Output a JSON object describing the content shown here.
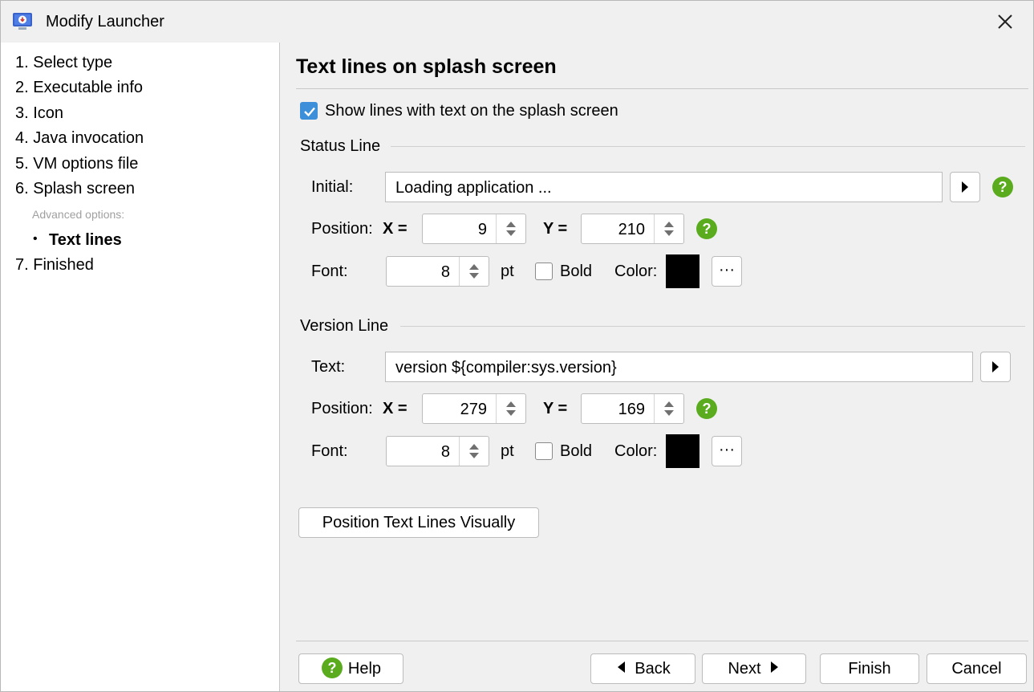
{
  "window": {
    "title": "Modify Launcher"
  },
  "sidebar": {
    "steps": [
      {
        "label": "1. Select type"
      },
      {
        "label": "2. Executable info"
      },
      {
        "label": "3. Icon"
      },
      {
        "label": "4. Java invocation"
      },
      {
        "label": "5. VM options file"
      },
      {
        "label": "6. Splash screen"
      }
    ],
    "advanced_label": "Advanced options:",
    "bullet": "•",
    "current_item": "Text lines",
    "final_step": "7. Finished"
  },
  "main": {
    "heading": "Text lines on splash screen",
    "show_lines": {
      "label": "Show lines with text on the splash screen",
      "checked": true
    },
    "status_line": {
      "section_label": "Status Line",
      "initial_label": "Initial:",
      "initial_value": "Loading application ...",
      "position_label": "Position:",
      "x_label": "X =",
      "x_value": "9",
      "y_label": "Y =",
      "y_value": "210",
      "font_label": "Font:",
      "font_size": "8",
      "unit": "pt",
      "bold_label": "Bold",
      "color_label": "Color:",
      "color_value": "#000000",
      "more_label": "···"
    },
    "version_line": {
      "section_label": "Version Line",
      "text_label": "Text:",
      "text_value": "version ${compiler:sys.version}",
      "position_label": "Position:",
      "x_label": "X =",
      "x_value": "279",
      "y_label": "Y =",
      "y_value": "169",
      "font_label": "Font:",
      "font_size": "8",
      "unit": "pt",
      "bold_label": "Bold",
      "color_label": "Color:",
      "color_value": "#000000",
      "more_label": "···"
    },
    "position_visually_label": "Position Text Lines Visually"
  },
  "footer": {
    "help_label": "Help",
    "back_label": "Back",
    "next_label": "Next",
    "finish_label": "Finish",
    "cancel_label": "Cancel"
  },
  "colors": {
    "accent": "#3c8fd8",
    "help_green": "#5aac1e"
  },
  "icons": {
    "app": "launcher-download-icon",
    "close": "close-icon",
    "help": "question-circle-icon",
    "arrow": "triangle-right-icon",
    "back": "triangle-left-icon"
  }
}
